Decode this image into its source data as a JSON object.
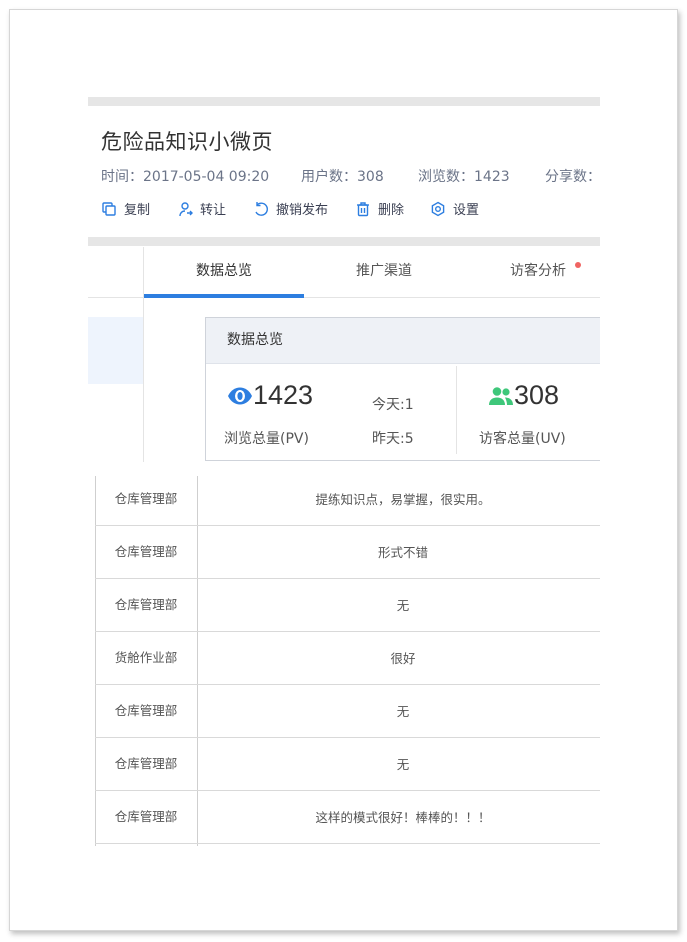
{
  "page": {
    "title": "危险品知识小微页",
    "meta": {
      "time": "时间：2017-05-04 09:20",
      "users": "用户数：308",
      "views": "浏览数：1423",
      "shares": "分享数："
    },
    "actions": [
      {
        "label": "复制",
        "icon": "copy-icon"
      },
      {
        "label": "转让",
        "icon": "user-transfer-icon"
      },
      {
        "label": "撤销发布",
        "icon": "undo-icon"
      },
      {
        "label": "删除",
        "icon": "trash-icon"
      },
      {
        "label": "设置",
        "icon": "gear-icon"
      }
    ]
  },
  "tabs": [
    {
      "label": "数据总览",
      "active": true
    },
    {
      "label": "推广渠道",
      "active": false
    },
    {
      "label": "访客分析",
      "active": false,
      "badge_dot": true
    }
  ],
  "overview": {
    "header": "数据总览",
    "pv": {
      "value": "1423",
      "label": "浏览总量(PV)",
      "icon": "eye-icon",
      "icon_color": "#2d7ee0"
    },
    "today": "今天:1",
    "yesterday": "昨天:5",
    "uv": {
      "value": "308",
      "label": "访客总量(UV)",
      "icon": "users-icon",
      "icon_color": "#3ec77a"
    }
  },
  "comments": [
    {
      "dept": "仓库管理部",
      "comment": "提练知识点，易掌握，很实用。"
    },
    {
      "dept": "仓库管理部",
      "comment": "形式不错"
    },
    {
      "dept": "仓库管理部",
      "comment": "无"
    },
    {
      "dept": "货舱作业部",
      "comment": "很好"
    },
    {
      "dept": "仓库管理部",
      "comment": "无"
    },
    {
      "dept": "仓库管理部",
      "comment": "无"
    },
    {
      "dept": "仓库管理部",
      "comment": "这样的模式很好！棒棒的！！！"
    }
  ],
  "colors": {
    "accent": "#2d7ee0",
    "badge": "#f06462",
    "uv_green": "#3ec77a"
  }
}
